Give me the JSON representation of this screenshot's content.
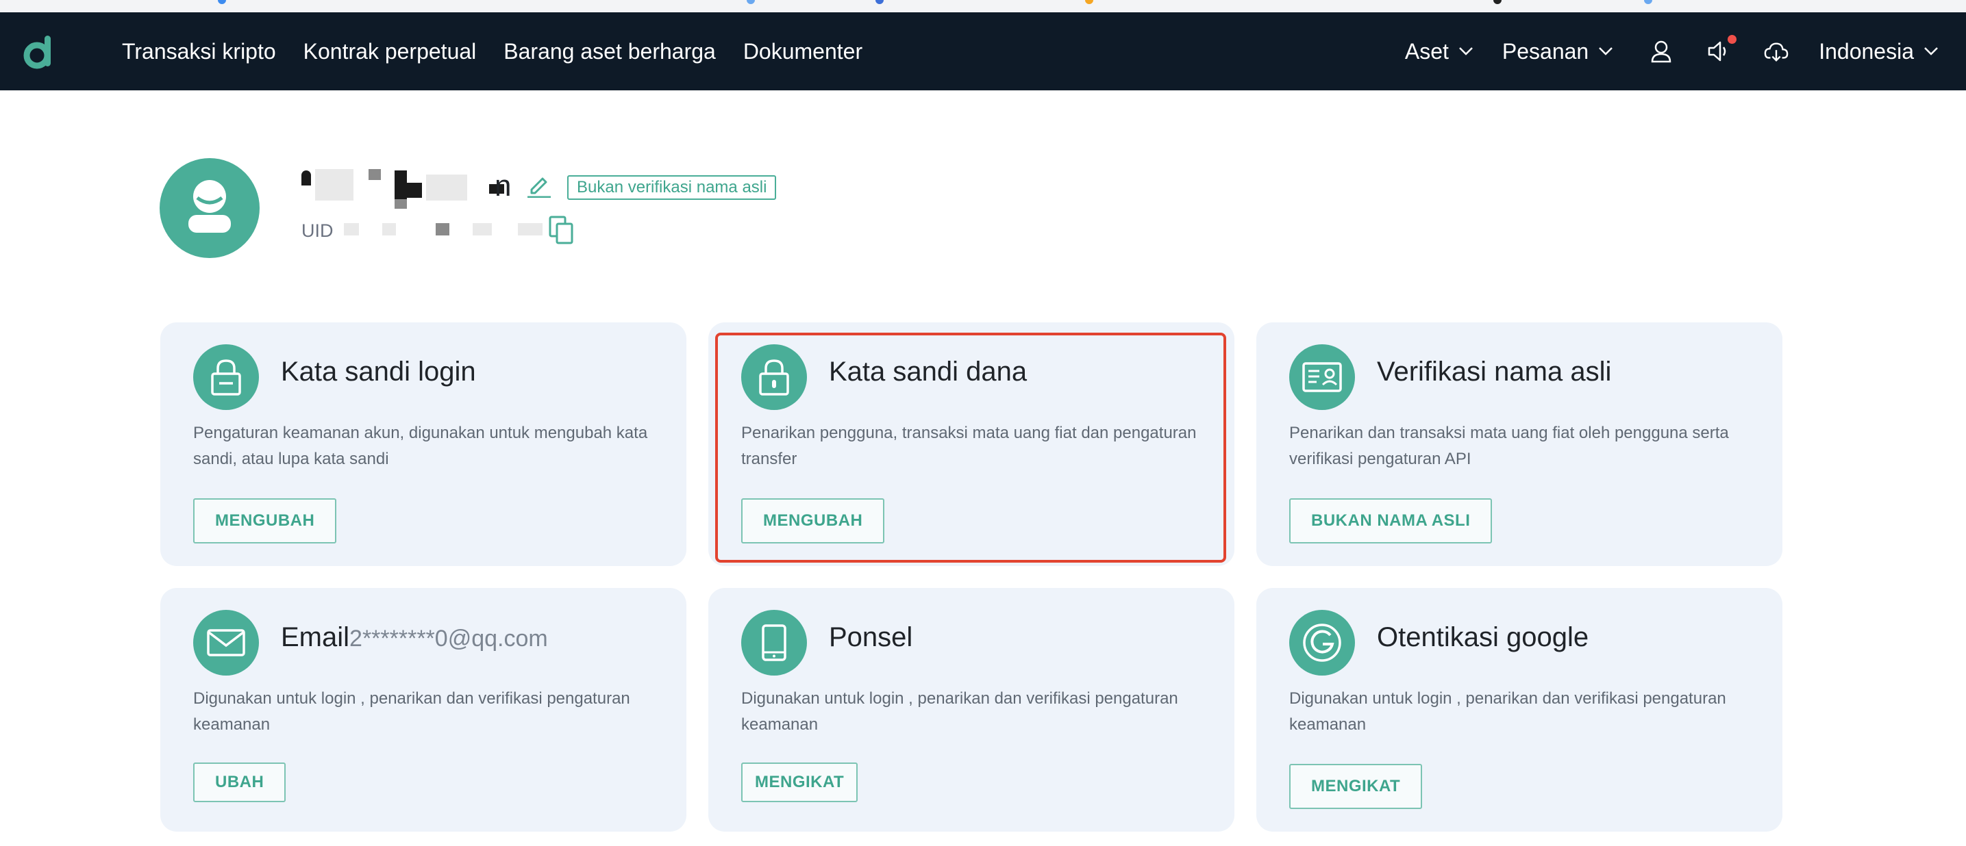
{
  "nav": {
    "links": [
      "Transaksi kripto",
      "Kontrak perpetual",
      "Barang aset berharga",
      "Dokumenter"
    ],
    "aset_label": "Aset",
    "pesanan_label": "Pesanan",
    "language_label": "Indonesia"
  },
  "profile": {
    "name_tail": "n",
    "verify_badge": "Bukan verifikasi nama asli",
    "uid_label": "UID"
  },
  "cards": [
    {
      "title": "Kata sandi login",
      "subtitle": "",
      "description": "Pengaturan keamanan akun, digunakan untuk mengubah kata sandi, atau lupa kata sandi",
      "button": "MENGUBAH",
      "icon": "lock-icon"
    },
    {
      "title": "Kata sandi dana",
      "subtitle": "",
      "description": "Penarikan pengguna, transaksi mata uang fiat dan pengaturan transfer",
      "button": "MENGUBAH",
      "icon": "lock-icon"
    },
    {
      "title": "Verifikasi nama asli",
      "subtitle": "",
      "description": "Penarikan dan transaksi mata uang fiat oleh pengguna serta verifikasi pengaturan API",
      "button": "BUKAN NAMA ASLI",
      "icon": "id-card-icon"
    },
    {
      "title": "Email",
      "subtitle": "2********0@qq.com",
      "description": "Digunakan untuk login , penarikan dan verifikasi pengaturan keamanan",
      "button": "UBAH",
      "icon": "envelope-icon"
    },
    {
      "title": "Ponsel",
      "subtitle": "",
      "description": "Digunakan untuk login , penarikan dan verifikasi pengaturan keamanan",
      "button": "MENGIKAT",
      "icon": "phone-icon"
    },
    {
      "title": "Otentikasi google",
      "subtitle": "",
      "description": "Digunakan untuk login , penarikan dan verifikasi pengaturan keamanan",
      "button": "MENGIKAT",
      "icon": "google-icon"
    }
  ],
  "colors": {
    "navbar": "#0e1a27",
    "accent": "#4aae98",
    "card_bg": "#eef3fa",
    "highlight": "#e2432f",
    "notification_dot": "#f0504a"
  }
}
